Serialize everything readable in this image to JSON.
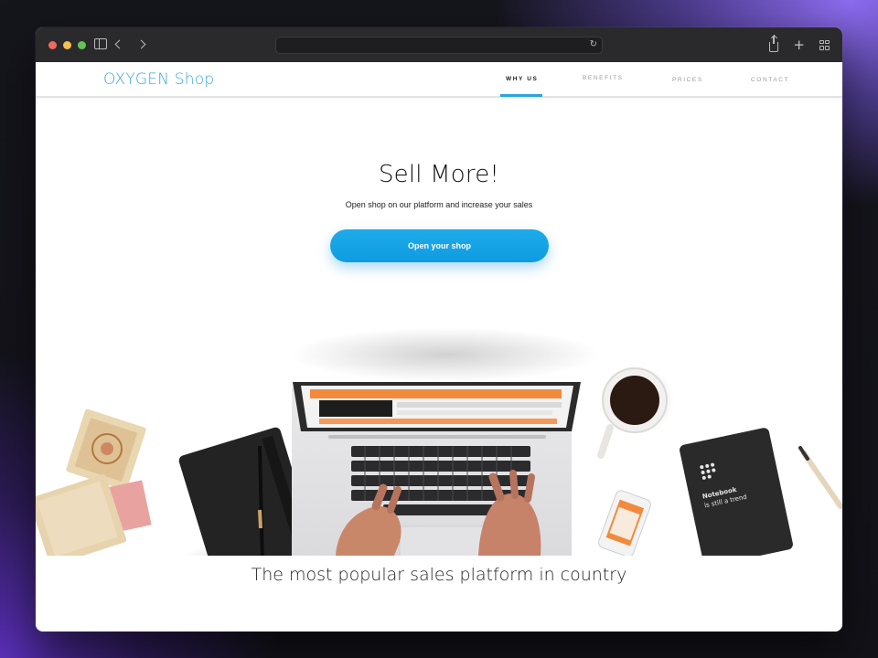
{
  "site": {
    "logo": "OXYGEN Shop",
    "nav": [
      {
        "label": "WHY US",
        "active": true
      },
      {
        "label": "BENEFITS",
        "active": false
      },
      {
        "label": "PRICES",
        "active": false
      },
      {
        "label": "CONTACT",
        "active": false
      }
    ],
    "hero": {
      "title": "Sell More!",
      "subtitle": "Open shop on our platform and increase your sales",
      "cta_label": "Open your shop"
    },
    "notebook_text_line1": "Notebook",
    "notebook_text_line2": "is still a trend",
    "tagline": "The most popular sales platform in country"
  },
  "colors": {
    "accent": "#2aa5e0",
    "logo": "#3aa6d6",
    "window_chrome": "#2a2a2c"
  },
  "icons": [
    "sidebar-icon",
    "back-icon",
    "forward-icon",
    "reload-icon",
    "share-icon",
    "new-tab-icon",
    "tab-overview-icon"
  ]
}
